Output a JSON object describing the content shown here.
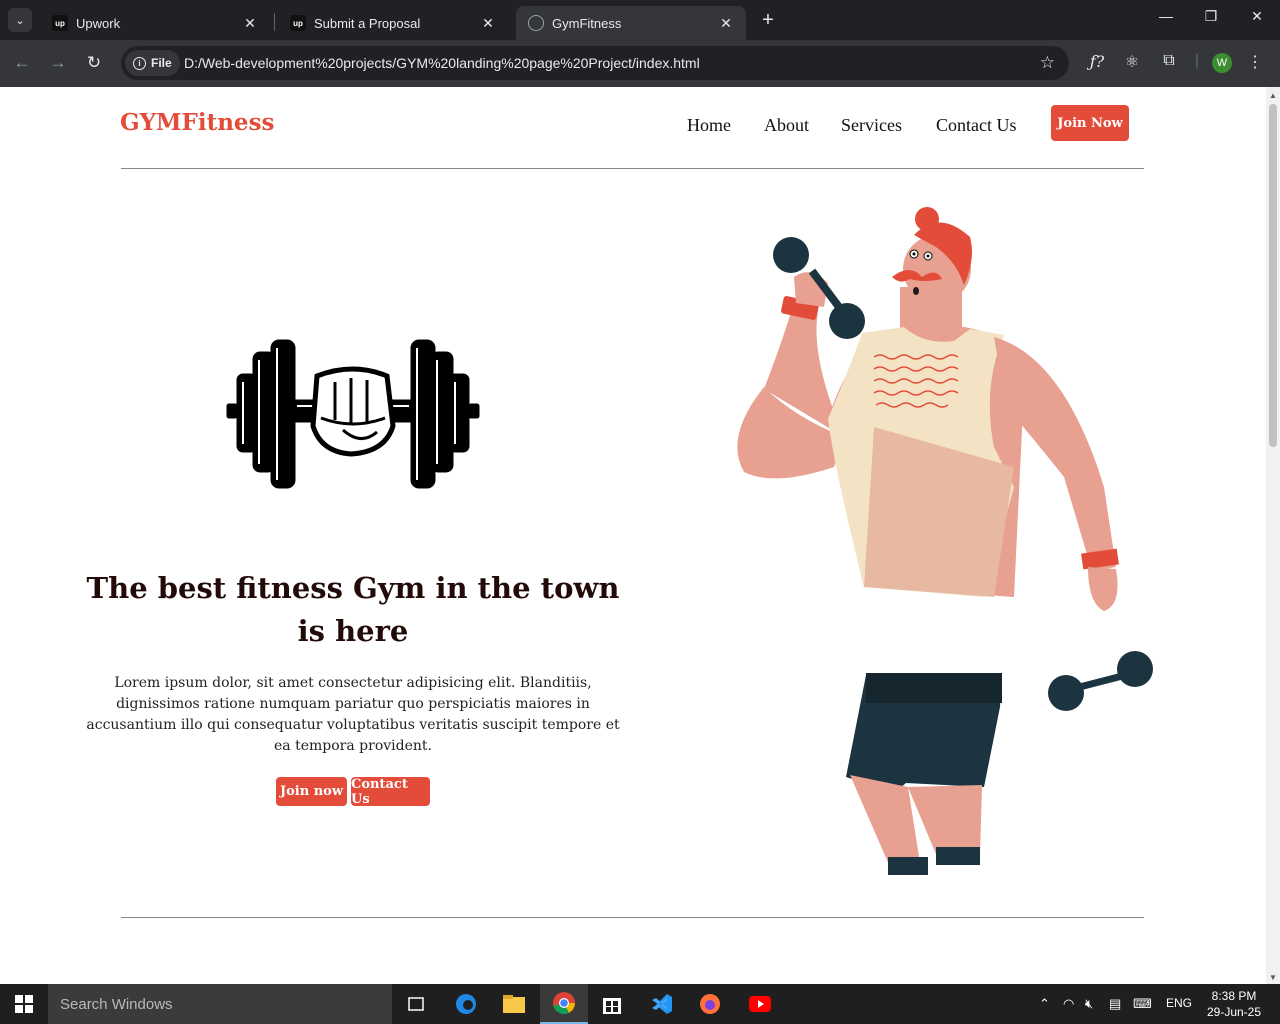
{
  "browser": {
    "tabs": [
      {
        "title": "Upwork",
        "icon": "up"
      },
      {
        "title": "Submit a Proposal",
        "icon": "up"
      },
      {
        "title": "GymFitness",
        "icon": "globe"
      }
    ],
    "site_chip": "File",
    "url": "D:/Web-development%20projects/GYM%20landing%20page%20Project/index.html",
    "profile_initial": "W"
  },
  "page": {
    "logo": "GYMFitness",
    "nav": [
      "Home",
      "About",
      "Services",
      "Contact Us"
    ],
    "join_button": "Join Now",
    "hero": {
      "title": "The best fitness Gym in the town is here",
      "text": "Lorem ipsum dolor, sit amet consectetur adipisicing elit. Blanditiis, dignissimos ratione numquam pariatur quo perspiciatis maiores in accusantium illo qui consequatur voluptatibus veritatis suscipit tempore et ea tempora provident.",
      "buttons": [
        "Join now",
        "Contact Us"
      ]
    },
    "accent_color": "#e44c3a"
  },
  "taskbar": {
    "search_placeholder": "Search Windows",
    "language": "ENG",
    "time": "8:38 PM",
    "date": "29-Jun-25"
  }
}
